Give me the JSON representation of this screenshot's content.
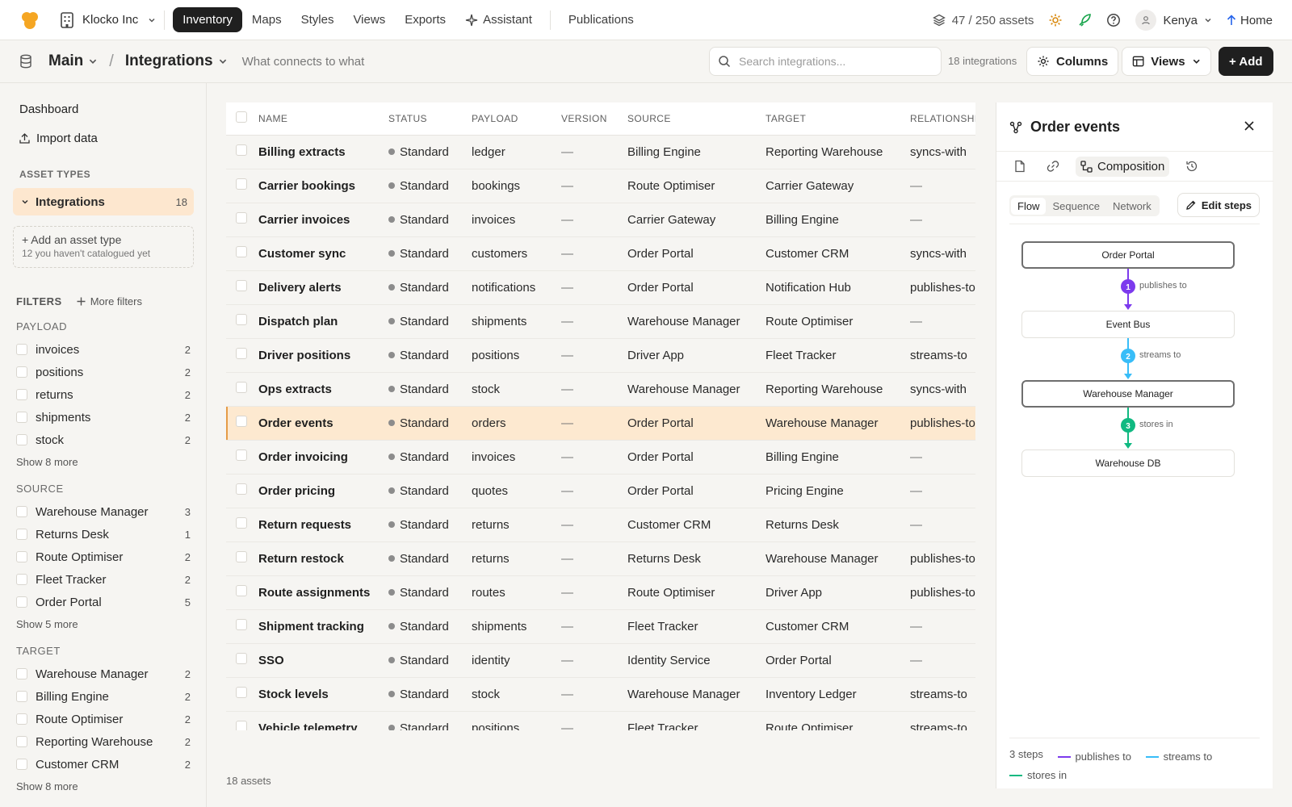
{
  "topbar": {
    "org": "Klocko Inc",
    "tabs": [
      {
        "label": "Inventory",
        "active": true
      },
      {
        "label": "Maps"
      },
      {
        "label": "Styles"
      },
      {
        "label": "Views"
      },
      {
        "label": "Exports"
      },
      {
        "label": "Assistant",
        "icon": "sparkle-icon"
      }
    ],
    "publications": "Publications",
    "assets_count": "47 / 250  assets",
    "user": "Kenya",
    "home": "Home",
    "colors": {
      "brand": "#f5a623",
      "active_tab": "#1f1f1f",
      "accent": "#2563eb"
    }
  },
  "subbar": {
    "crumb1": "Main",
    "crumb_sep": "/",
    "crumb2": "Integrations",
    "subtitle": "What connects to what",
    "search_placeholder": "Search integrations...",
    "count": "18 integrations",
    "columns": "Columns",
    "views": "Views",
    "add": "+ Add"
  },
  "sidebar": {
    "dashboard": "Dashboard",
    "import": "Import data",
    "asset_types_head": "ASSET TYPES",
    "asset_selected": {
      "label": "Integrations",
      "count": "18"
    },
    "add_type": "+ Add an asset type",
    "add_type_sub": "12 you haven't catalogued yet",
    "filters_head": "FILTERS",
    "more_filters": "More filters",
    "groups": [
      {
        "title": "PAYLOAD",
        "items": [
          {
            "label": "invoices",
            "count": "2"
          },
          {
            "label": "positions",
            "count": "2"
          },
          {
            "label": "returns",
            "count": "2"
          },
          {
            "label": "shipments",
            "count": "2"
          },
          {
            "label": "stock",
            "count": "2"
          }
        ],
        "more": "Show 8 more"
      },
      {
        "title": "SOURCE",
        "items": [
          {
            "label": "Warehouse Manager",
            "count": "3"
          },
          {
            "label": "Returns Desk",
            "count": "1"
          },
          {
            "label": "Route Optimiser",
            "count": "2"
          },
          {
            "label": "Fleet Tracker",
            "count": "2"
          },
          {
            "label": "Order Portal",
            "count": "5"
          }
        ],
        "more": "Show 5 more"
      },
      {
        "title": "TARGET",
        "items": [
          {
            "label": "Warehouse Manager",
            "count": "2"
          },
          {
            "label": "Billing Engine",
            "count": "2"
          },
          {
            "label": "Route Optimiser",
            "count": "2"
          },
          {
            "label": "Reporting Warehouse",
            "count": "2"
          },
          {
            "label": "Customer CRM",
            "count": "2"
          }
        ],
        "more": "Show 8 more"
      }
    ]
  },
  "table": {
    "columns": [
      "NAME",
      "STATUS",
      "PAYLOAD",
      "VERSION",
      "SOURCE",
      "TARGET",
      "RELATIONSHIP"
    ],
    "selected_row": "Order events",
    "rows": [
      {
        "name": "Billing extracts",
        "status": "Standard",
        "payload": "ledger",
        "version": "—",
        "source": "Billing Engine",
        "target": "Reporting Warehouse",
        "relationship": "syncs-with"
      },
      {
        "name": "Carrier bookings",
        "status": "Standard",
        "payload": "bookings",
        "version": "—",
        "source": "Route Optimiser",
        "target": "Carrier Gateway",
        "relationship": "—"
      },
      {
        "name": "Carrier invoices",
        "status": "Standard",
        "payload": "invoices",
        "version": "—",
        "source": "Carrier Gateway",
        "target": "Billing Engine",
        "relationship": "—"
      },
      {
        "name": "Customer sync",
        "status": "Standard",
        "payload": "customers",
        "version": "—",
        "source": "Order Portal",
        "target": "Customer CRM",
        "relationship": "syncs-with"
      },
      {
        "name": "Delivery alerts",
        "status": "Standard",
        "payload": "notifications",
        "version": "—",
        "source": "Order Portal",
        "target": "Notification Hub",
        "relationship": "publishes-to"
      },
      {
        "name": "Dispatch plan",
        "status": "Standard",
        "payload": "shipments",
        "version": "—",
        "source": "Warehouse Manager",
        "target": "Route Optimiser",
        "relationship": "—"
      },
      {
        "name": "Driver positions",
        "status": "Standard",
        "payload": "positions",
        "version": "—",
        "source": "Driver App",
        "target": "Fleet Tracker",
        "relationship": "streams-to"
      },
      {
        "name": "Ops extracts",
        "status": "Standard",
        "payload": "stock",
        "version": "—",
        "source": "Warehouse Manager",
        "target": "Reporting Warehouse",
        "relationship": "syncs-with"
      },
      {
        "name": "Order events",
        "status": "Standard",
        "payload": "orders",
        "version": "—",
        "source": "Order Portal",
        "target": "Warehouse Manager",
        "relationship": "publishes-to"
      },
      {
        "name": "Order invoicing",
        "status": "Standard",
        "payload": "invoices",
        "version": "—",
        "source": "Order Portal",
        "target": "Billing Engine",
        "relationship": "—"
      },
      {
        "name": "Order pricing",
        "status": "Standard",
        "payload": "quotes",
        "version": "—",
        "source": "Order Portal",
        "target": "Pricing Engine",
        "relationship": "—"
      },
      {
        "name": "Return requests",
        "status": "Standard",
        "payload": "returns",
        "version": "—",
        "source": "Customer CRM",
        "target": "Returns Desk",
        "relationship": "—"
      },
      {
        "name": "Return restock",
        "status": "Standard",
        "payload": "returns",
        "version": "—",
        "source": "Returns Desk",
        "target": "Warehouse Manager",
        "relationship": "publishes-to"
      },
      {
        "name": "Route assignments",
        "status": "Standard",
        "payload": "routes",
        "version": "—",
        "source": "Route Optimiser",
        "target": "Driver App",
        "relationship": "publishes-to"
      },
      {
        "name": "Shipment tracking",
        "status": "Standard",
        "payload": "shipments",
        "version": "—",
        "source": "Fleet Tracker",
        "target": "Customer CRM",
        "relationship": "—"
      },
      {
        "name": "SSO",
        "status": "Standard",
        "payload": "identity",
        "version": "—",
        "source": "Identity Service",
        "target": "Order Portal",
        "relationship": "—"
      },
      {
        "name": "Stock levels",
        "status": "Standard",
        "payload": "stock",
        "version": "—",
        "source": "Warehouse Manager",
        "target": "Inventory Ledger",
        "relationship": "streams-to"
      },
      {
        "name": "Vehicle telemetry",
        "status": "Standard",
        "payload": "positions",
        "version": "—",
        "source": "Fleet Tracker",
        "target": "Route Optimiser",
        "relationship": "streams-to"
      }
    ],
    "footer": "18 assets"
  },
  "panel": {
    "title": "Order events",
    "tabs": [
      {
        "icon": "document-icon"
      },
      {
        "icon": "link-icon"
      },
      {
        "icon": "composition-icon",
        "label": "Composition",
        "active": true
      },
      {
        "icon": "history-icon"
      }
    ],
    "segments": [
      {
        "label": "Flow",
        "active": true
      },
      {
        "label": "Sequence"
      },
      {
        "label": "Network"
      }
    ],
    "edit_steps": "Edit steps",
    "flow": {
      "nodes": [
        "Order Portal",
        "Event Bus",
        "Warehouse Manager",
        "Warehouse DB"
      ],
      "edges": [
        {
          "step": "1",
          "label": "publishes to",
          "color": "#7c3aed"
        },
        {
          "step": "2",
          "label": "streams to",
          "color": "#38bdf8"
        },
        {
          "step": "3",
          "label": "stores in",
          "color": "#10b981"
        }
      ]
    },
    "legend": {
      "steps": "3 steps",
      "items": [
        {
          "label": "publishes to",
          "color": "#7c3aed"
        },
        {
          "label": "streams to",
          "color": "#38bdf8"
        },
        {
          "label": "stores in",
          "color": "#10b981"
        }
      ]
    }
  }
}
